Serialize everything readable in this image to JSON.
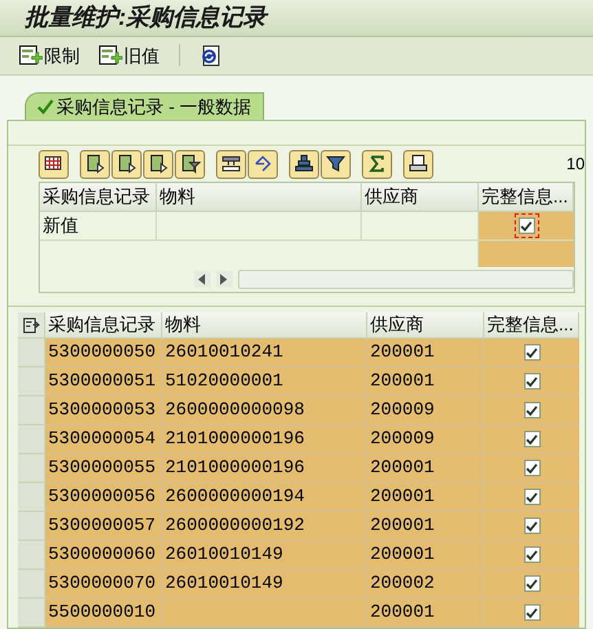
{
  "window": {
    "title": "批量维护:采购信息记录"
  },
  "toolbar": [
    {
      "label": "限制"
    },
    {
      "label": "旧值"
    }
  ],
  "tabs": [
    {
      "label": "采购信息记录 - 一般数据",
      "selected": true
    }
  ],
  "page_indicator": "10",
  "entry_table": {
    "columns": [
      "采购信息记录",
      "物料",
      "供应商",
      "完整信息..."
    ],
    "rows": [
      {
        "record": "新值",
        "complete": true
      }
    ]
  },
  "records_table": {
    "columns": [
      "采购信息记录",
      "物料",
      "供应商",
      "完整信息..."
    ],
    "rows": [
      {
        "record": "5300000050",
        "material": "26010010241",
        "supplier": "200001",
        "complete": true
      },
      {
        "record": "5300000051",
        "material": "51020000001",
        "supplier": "200001",
        "complete": true
      },
      {
        "record": "5300000053",
        "material": "2600000000098",
        "supplier": "200009",
        "complete": true
      },
      {
        "record": "5300000054",
        "material": "2101000000196",
        "supplier": "200009",
        "complete": true
      },
      {
        "record": "5300000055",
        "material": "2101000000196",
        "supplier": "200001",
        "complete": true
      },
      {
        "record": "5300000056",
        "material": "2600000000194",
        "supplier": "200001",
        "complete": true
      },
      {
        "record": "5300000057",
        "material": "2600000000192",
        "supplier": "200001",
        "complete": true
      },
      {
        "record": "5300000060",
        "material": "26010010149",
        "supplier": "200001",
        "complete": true
      },
      {
        "record": "5300000070",
        "material": "26010010149",
        "supplier": "200002",
        "complete": true
      },
      {
        "record": "5500000010",
        "supplier": "200001",
        "complete": true
      }
    ]
  }
}
